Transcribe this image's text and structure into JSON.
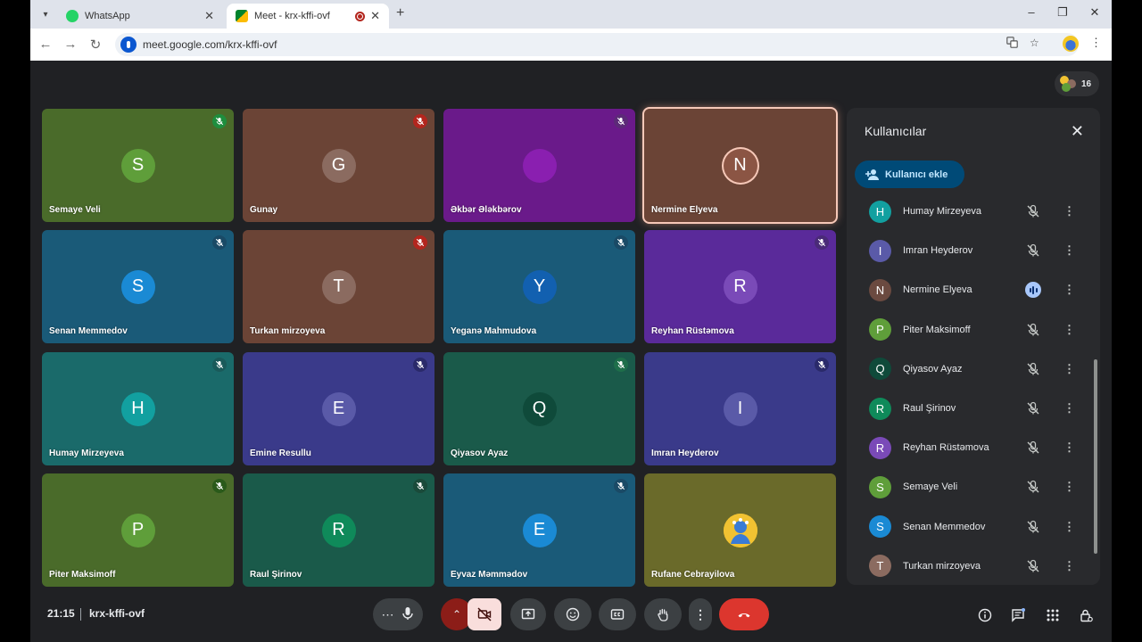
{
  "browser": {
    "tabs": [
      {
        "title": "WhatsApp",
        "favicon_color": "#25d366"
      },
      {
        "title": "Meet - krx-kffi-ovf",
        "favicon_color": "#00832d",
        "recording": true
      }
    ],
    "url": "meet.google.com/krx-kffi-ovf",
    "controls": {
      "new_tab": "+",
      "minimize": "–",
      "maximize": "❐",
      "close": "✕",
      "back": "←",
      "forward": "→",
      "reload": "↻"
    }
  },
  "meet": {
    "participant_count": "16",
    "tiles": [
      {
        "name": "Semaye Veli",
        "initial": "S",
        "bg": "#4a6b2a",
        "avatar": "#5f9e3a",
        "mic": "#1e8e3e"
      },
      {
        "name": "Gunay",
        "initial": "G",
        "bg": "#6b4436",
        "avatar": "#8b6b60",
        "mic": "#b3261e"
      },
      {
        "name": "Əkbər Ələkbərov",
        "initial": "",
        "bg": "#6a1a8a",
        "avatar": "#8a1fb0",
        "mic": "#5c2a78"
      },
      {
        "name": "Nermine Elyeva",
        "initial": "N",
        "bg": "#6b4436",
        "avatar": "#8b5544",
        "speaking": true
      },
      {
        "name": "Senan Memmedov",
        "initial": "S",
        "bg": "#1a5a78",
        "avatar": "#1a8ad4",
        "mic": "#1a4a66"
      },
      {
        "name": "Turkan mirzoyeva",
        "initial": "T",
        "bg": "#6b4436",
        "avatar": "#8b6b60",
        "mic": "#b3261e"
      },
      {
        "name": "Yeganə Mahmudova",
        "initial": "Y",
        "bg": "#1a5a78",
        "avatar": "#1260b0",
        "mic": "#1a4a66"
      },
      {
        "name": "Reyhan Rüstəmova",
        "initial": "R",
        "bg": "#5a2a9a",
        "avatar": "#7a4ab8",
        "mic": "#4a2a78"
      },
      {
        "name": "Humay Mirzeyeva",
        "initial": "H",
        "bg": "#1a6a6a",
        "avatar": "#12a0a0",
        "mic": "#1a5a5a"
      },
      {
        "name": "Emine Resullu",
        "initial": "E",
        "bg": "#3a3a8a",
        "avatar": "#5a5aa8",
        "mic": "#2a2a6a"
      },
      {
        "name": "Qiyasov Ayaz",
        "initial": "Q",
        "bg": "#1a5a4a",
        "avatar": "#0f4a3a",
        "mic": "#1e6e4a"
      },
      {
        "name": "Imran Heyderov",
        "initial": "I",
        "bg": "#3a3a8a",
        "avatar": "#5a5aa8",
        "mic": "#2a2a6a"
      },
      {
        "name": "Piter Maksimoff",
        "initial": "P",
        "bg": "#4a6b2a",
        "avatar": "#5f9e3a",
        "mic": "#2a5a1a"
      },
      {
        "name": "Raul Şirinov",
        "initial": "R",
        "bg": "#1a5a4a",
        "avatar": "#0f8a5a",
        "mic": "#1a4a3a"
      },
      {
        "name": "Eyvaz Məmmədov",
        "initial": "E",
        "bg": "#1a5a78",
        "avatar": "#1a8ad4",
        "mic": "#1a4a66"
      },
      {
        "name": "Rufane Cebrayilova",
        "initial": "",
        "bg": "#6a6a2a",
        "avatar": "#f1c232",
        "photo": true
      }
    ],
    "panel": {
      "title": "Kullanıcılar",
      "add_user_label": "Kullanıcı ekle",
      "participants": [
        {
          "name": "Humay Mirzeyeva",
          "initial": "H",
          "color": "#12a0a0"
        },
        {
          "name": "Imran Heyderov",
          "initial": "I",
          "color": "#5a5aa8"
        },
        {
          "name": "Nermine Elyeva",
          "initial": "N",
          "color": "#6b4a40",
          "speaking": true
        },
        {
          "name": "Piter Maksimoff",
          "initial": "P",
          "color": "#5f9e3a"
        },
        {
          "name": "Qiyasov Ayaz",
          "initial": "Q",
          "color": "#0f4a3a"
        },
        {
          "name": "Raul Şirinov",
          "initial": "R",
          "color": "#0f8a5a"
        },
        {
          "name": "Reyhan Rüstəmova",
          "initial": "R",
          "color": "#7a4ab8"
        },
        {
          "name": "Semaye Veli",
          "initial": "S",
          "color": "#5f9e3a"
        },
        {
          "name": "Senan Memmedov",
          "initial": "S",
          "color": "#1a8ad4"
        },
        {
          "name": "Turkan mirzoyeva",
          "initial": "T",
          "color": "#8b6b60"
        }
      ]
    },
    "bottom": {
      "time": "21:15",
      "meeting_code": "krx-kffi-ovf"
    }
  }
}
